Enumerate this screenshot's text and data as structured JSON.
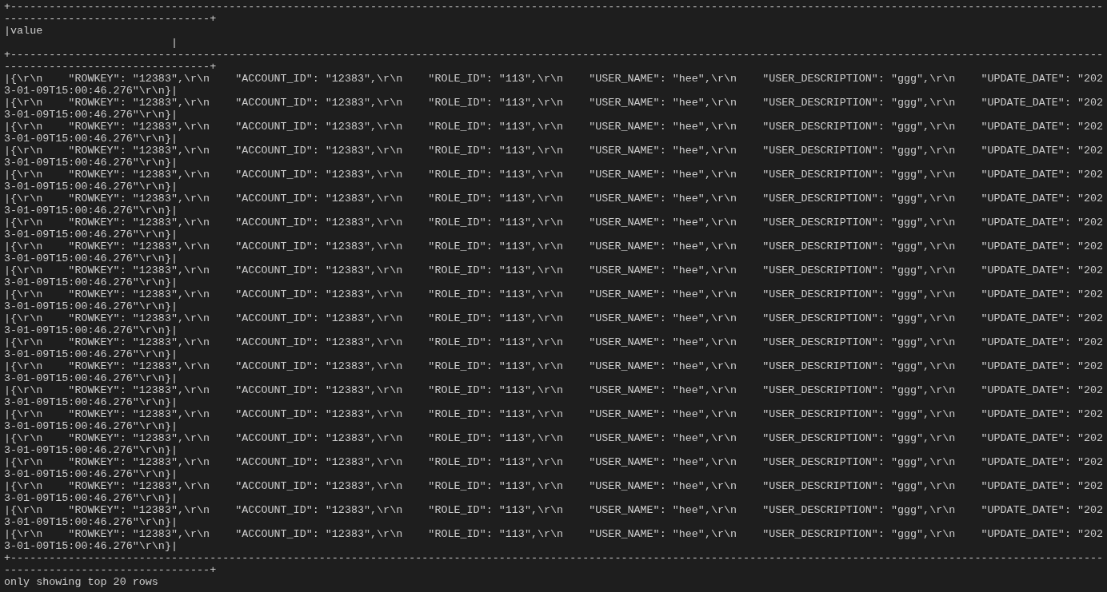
{
  "table": {
    "top_border": "+----------------------------------------------------------------------------------------------------------------------------------------------------------------------------------------------------------+",
    "header": "|value                                                                                                                                                                                               |",
    "header_border": "+----------------------------------------------------------------------------------------------------------------------------------------------------------------------------------------------------------+",
    "rows": [
      "|{\\r\\n    \"ROWKEY\": \"12383\",\\r\\n    \"ACCOUNT_ID\": \"12383\",\\r\\n    \"ROLE_ID\": \"113\",\\r\\n    \"USER_NAME\": \"hee\",\\r\\n    \"USER_DESCRIPTION\": \"ggg\",\\r\\n    \"UPDATE_DATE\": \"2023-01-09T15:00:46.276\"\\r\\n}|",
      "|{\\r\\n    \"ROWKEY\": \"12383\",\\r\\n    \"ACCOUNT_ID\": \"12383\",\\r\\n    \"ROLE_ID\": \"113\",\\r\\n    \"USER_NAME\": \"hee\",\\r\\n    \"USER_DESCRIPTION\": \"ggg\",\\r\\n    \"UPDATE_DATE\": \"2023-01-09T15:00:46.276\"\\r\\n}|",
      "|{\\r\\n    \"ROWKEY\": \"12383\",\\r\\n    \"ACCOUNT_ID\": \"12383\",\\r\\n    \"ROLE_ID\": \"113\",\\r\\n    \"USER_NAME\": \"hee\",\\r\\n    \"USER_DESCRIPTION\": \"ggg\",\\r\\n    \"UPDATE_DATE\": \"2023-01-09T15:00:46.276\"\\r\\n}|",
      "|{\\r\\n    \"ROWKEY\": \"12383\",\\r\\n    \"ACCOUNT_ID\": \"12383\",\\r\\n    \"ROLE_ID\": \"113\",\\r\\n    \"USER_NAME\": \"hee\",\\r\\n    \"USER_DESCRIPTION\": \"ggg\",\\r\\n    \"UPDATE_DATE\": \"2023-01-09T15:00:46.276\"\\r\\n}|",
      "|{\\r\\n    \"ROWKEY\": \"12383\",\\r\\n    \"ACCOUNT_ID\": \"12383\",\\r\\n    \"ROLE_ID\": \"113\",\\r\\n    \"USER_NAME\": \"hee\",\\r\\n    \"USER_DESCRIPTION\": \"ggg\",\\r\\n    \"UPDATE_DATE\": \"2023-01-09T15:00:46.276\"\\r\\n}|",
      "|{\\r\\n    \"ROWKEY\": \"12383\",\\r\\n    \"ACCOUNT_ID\": \"12383\",\\r\\n    \"ROLE_ID\": \"113\",\\r\\n    \"USER_NAME\": \"hee\",\\r\\n    \"USER_DESCRIPTION\": \"ggg\",\\r\\n    \"UPDATE_DATE\": \"2023-01-09T15:00:46.276\"\\r\\n}|",
      "|{\\r\\n    \"ROWKEY\": \"12383\",\\r\\n    \"ACCOUNT_ID\": \"12383\",\\r\\n    \"ROLE_ID\": \"113\",\\r\\n    \"USER_NAME\": \"hee\",\\r\\n    \"USER_DESCRIPTION\": \"ggg\",\\r\\n    \"UPDATE_DATE\": \"2023-01-09T15:00:46.276\"\\r\\n}|",
      "|{\\r\\n    \"ROWKEY\": \"12383\",\\r\\n    \"ACCOUNT_ID\": \"12383\",\\r\\n    \"ROLE_ID\": \"113\",\\r\\n    \"USER_NAME\": \"hee\",\\r\\n    \"USER_DESCRIPTION\": \"ggg\",\\r\\n    \"UPDATE_DATE\": \"2023-01-09T15:00:46.276\"\\r\\n}|",
      "|{\\r\\n    \"ROWKEY\": \"12383\",\\r\\n    \"ACCOUNT_ID\": \"12383\",\\r\\n    \"ROLE_ID\": \"113\",\\r\\n    \"USER_NAME\": \"hee\",\\r\\n    \"USER_DESCRIPTION\": \"ggg\",\\r\\n    \"UPDATE_DATE\": \"2023-01-09T15:00:46.276\"\\r\\n}|",
      "|{\\r\\n    \"ROWKEY\": \"12383\",\\r\\n    \"ACCOUNT_ID\": \"12383\",\\r\\n    \"ROLE_ID\": \"113\",\\r\\n    \"USER_NAME\": \"hee\",\\r\\n    \"USER_DESCRIPTION\": \"ggg\",\\r\\n    \"UPDATE_DATE\": \"2023-01-09T15:00:46.276\"\\r\\n}|",
      "|{\\r\\n    \"ROWKEY\": \"12383\",\\r\\n    \"ACCOUNT_ID\": \"12383\",\\r\\n    \"ROLE_ID\": \"113\",\\r\\n    \"USER_NAME\": \"hee\",\\r\\n    \"USER_DESCRIPTION\": \"ggg\",\\r\\n    \"UPDATE_DATE\": \"2023-01-09T15:00:46.276\"\\r\\n}|",
      "|{\\r\\n    \"ROWKEY\": \"12383\",\\r\\n    \"ACCOUNT_ID\": \"12383\",\\r\\n    \"ROLE_ID\": \"113\",\\r\\n    \"USER_NAME\": \"hee\",\\r\\n    \"USER_DESCRIPTION\": \"ggg\",\\r\\n    \"UPDATE_DATE\": \"2023-01-09T15:00:46.276\"\\r\\n}|",
      "|{\\r\\n    \"ROWKEY\": \"12383\",\\r\\n    \"ACCOUNT_ID\": \"12383\",\\r\\n    \"ROLE_ID\": \"113\",\\r\\n    \"USER_NAME\": \"hee\",\\r\\n    \"USER_DESCRIPTION\": \"ggg\",\\r\\n    \"UPDATE_DATE\": \"2023-01-09T15:00:46.276\"\\r\\n}|",
      "|{\\r\\n    \"ROWKEY\": \"12383\",\\r\\n    \"ACCOUNT_ID\": \"12383\",\\r\\n    \"ROLE_ID\": \"113\",\\r\\n    \"USER_NAME\": \"hee\",\\r\\n    \"USER_DESCRIPTION\": \"ggg\",\\r\\n    \"UPDATE_DATE\": \"2023-01-09T15:00:46.276\"\\r\\n}|",
      "|{\\r\\n    \"ROWKEY\": \"12383\",\\r\\n    \"ACCOUNT_ID\": \"12383\",\\r\\n    \"ROLE_ID\": \"113\",\\r\\n    \"USER_NAME\": \"hee\",\\r\\n    \"USER_DESCRIPTION\": \"ggg\",\\r\\n    \"UPDATE_DATE\": \"2023-01-09T15:00:46.276\"\\r\\n}|",
      "|{\\r\\n    \"ROWKEY\": \"12383\",\\r\\n    \"ACCOUNT_ID\": \"12383\",\\r\\n    \"ROLE_ID\": \"113\",\\r\\n    \"USER_NAME\": \"hee\",\\r\\n    \"USER_DESCRIPTION\": \"ggg\",\\r\\n    \"UPDATE_DATE\": \"2023-01-09T15:00:46.276\"\\r\\n}|",
      "|{\\r\\n    \"ROWKEY\": \"12383\",\\r\\n    \"ACCOUNT_ID\": \"12383\",\\r\\n    \"ROLE_ID\": \"113\",\\r\\n    \"USER_NAME\": \"hee\",\\r\\n    \"USER_DESCRIPTION\": \"ggg\",\\r\\n    \"UPDATE_DATE\": \"2023-01-09T15:00:46.276\"\\r\\n}|",
      "|{\\r\\n    \"ROWKEY\": \"12383\",\\r\\n    \"ACCOUNT_ID\": \"12383\",\\r\\n    \"ROLE_ID\": \"113\",\\r\\n    \"USER_NAME\": \"hee\",\\r\\n    \"USER_DESCRIPTION\": \"ggg\",\\r\\n    \"UPDATE_DATE\": \"2023-01-09T15:00:46.276\"\\r\\n}|",
      "|{\\r\\n    \"ROWKEY\": \"12383\",\\r\\n    \"ACCOUNT_ID\": \"12383\",\\r\\n    \"ROLE_ID\": \"113\",\\r\\n    \"USER_NAME\": \"hee\",\\r\\n    \"USER_DESCRIPTION\": \"ggg\",\\r\\n    \"UPDATE_DATE\": \"2023-01-09T15:00:46.276\"\\r\\n}|",
      "|{\\r\\n    \"ROWKEY\": \"12383\",\\r\\n    \"ACCOUNT_ID\": \"12383\",\\r\\n    \"ROLE_ID\": \"113\",\\r\\n    \"USER_NAME\": \"hee\",\\r\\n    \"USER_DESCRIPTION\": \"ggg\",\\r\\n    \"UPDATE_DATE\": \"2023-01-09T15:00:46.276\"\\r\\n}|"
    ],
    "bottom_border": "+----------------------------------------------------------------------------------------------------------------------------------------------------------------------------------------------------------+"
  },
  "status_line": "only showing top 20 rows"
}
